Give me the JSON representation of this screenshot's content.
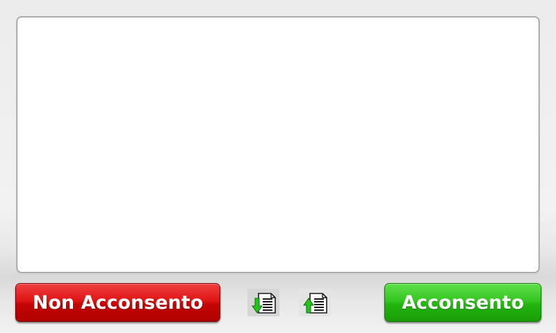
{
  "panel": {
    "content": ""
  },
  "buttons": {
    "reject_label": "Non Acconsento",
    "accept_label": "Acconsento",
    "reject_color": "#e01515",
    "accept_color": "#36c622"
  },
  "icons": {
    "download": "document-download-icon",
    "upload": "document-upload-icon"
  }
}
